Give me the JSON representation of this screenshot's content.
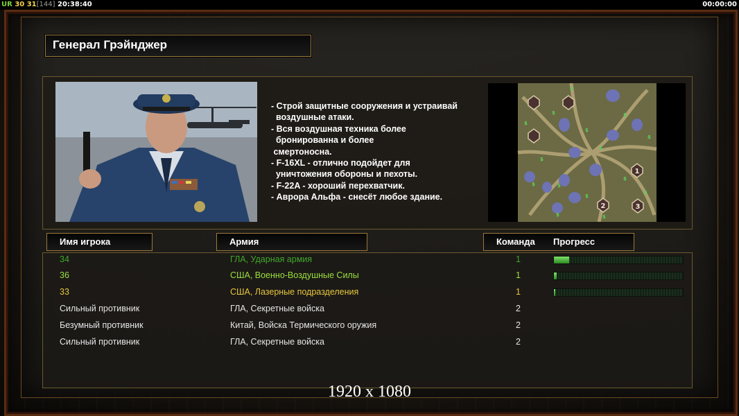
{
  "statusbar": {
    "ur": "UR",
    "v1": "30",
    "v2": "31",
    "v3": "[144]",
    "clock": "20:38:40",
    "timer": "00:00:00"
  },
  "general": {
    "name": "Генерал Грэйнджер"
  },
  "description": [
    "- Строй защитные сооружения и устраивай",
    "  воздушные атаки.",
    "- Вся воздушная техника более",
    "  бронированна и более",
    " смертоносна.",
    "- F-16XL - отлично подойдет для",
    "  уничтожения обороны и пехоты.",
    "- F-22A - хороший перехватчик.",
    "- Аврора Альфа - снесёт любое здание."
  ],
  "minimap": {
    "markers": [
      "1",
      "2",
      "3"
    ]
  },
  "table": {
    "headers": {
      "player": "Имя игрока",
      "army": "Армия",
      "team": "Команда",
      "progress": "Прогресс"
    },
    "rows": [
      {
        "player": "34",
        "army": "ГЛА, Ударная армия",
        "team": "1",
        "progress": 0.12,
        "color": "#3fa82c"
      },
      {
        "player": "36",
        "army": "США, Военно-Воздушные Силы",
        "team": "1",
        "progress": 0.02,
        "color": "#9ae03e"
      },
      {
        "player": "33",
        "army": "США, Лазерные подразделения",
        "team": "1",
        "progress": 0.01,
        "color": "#e7c73c"
      },
      {
        "player": "Сильный противник",
        "army": "ГЛА, Секретные войска",
        "team": "2",
        "progress": null,
        "color": "#e6e6e6"
      },
      {
        "player": "Безумный противник",
        "army": "Китай, Войска Термического оружия",
        "team": "2",
        "progress": null,
        "color": "#e6e6e6"
      },
      {
        "player": "Сильный противник",
        "army": "ГЛА, Секретные войска",
        "team": "2",
        "progress": null,
        "color": "#e6e6e6"
      }
    ]
  },
  "resolution": "1920 x 1080"
}
